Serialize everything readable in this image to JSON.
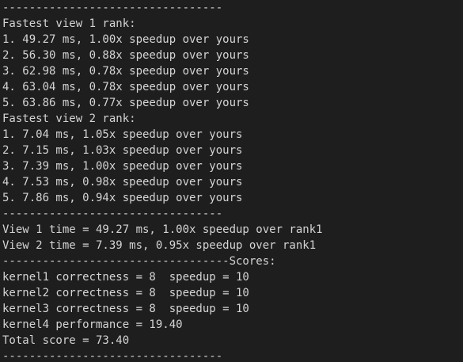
{
  "terminal": {
    "background_color": "#1e1e1e",
    "text_color": "#d4d4d4",
    "lines": [
      "---------------------------------",
      "Fastest view 1 rank:",
      "1. 49.27 ms, 1.00x speedup over yours",
      "2. 56.30 ms, 0.88x speedup over yours",
      "3. 62.98 ms, 0.78x speedup over yours",
      "4. 63.04 ms, 0.78x speedup over yours",
      "5. 63.86 ms, 0.77x speedup over yours",
      "Fastest view 2 rank:",
      "1. 7.04 ms, 1.05x speedup over yours",
      "2. 7.15 ms, 1.03x speedup over yours",
      "3. 7.39 ms, 1.00x speedup over yours",
      "4. 7.53 ms, 0.98x speedup over yours",
      "5. 7.86 ms, 0.94x speedup over yours",
      "---------------------------------",
      "View 1 time = 49.27 ms, 1.00x speedup over rank1",
      "View 2 time = 7.39 ms, 0.95x speedup over rank1",
      "----------------------------------Scores:",
      "kernel1 correctness = 8  speedup = 10",
      "kernel2 correctness = 8  speedup = 10",
      "kernel3 correctness = 8  speedup = 10",
      "kernel4 performance = 19.40",
      "Total score = 73.40",
      "---------------------------------"
    ]
  }
}
